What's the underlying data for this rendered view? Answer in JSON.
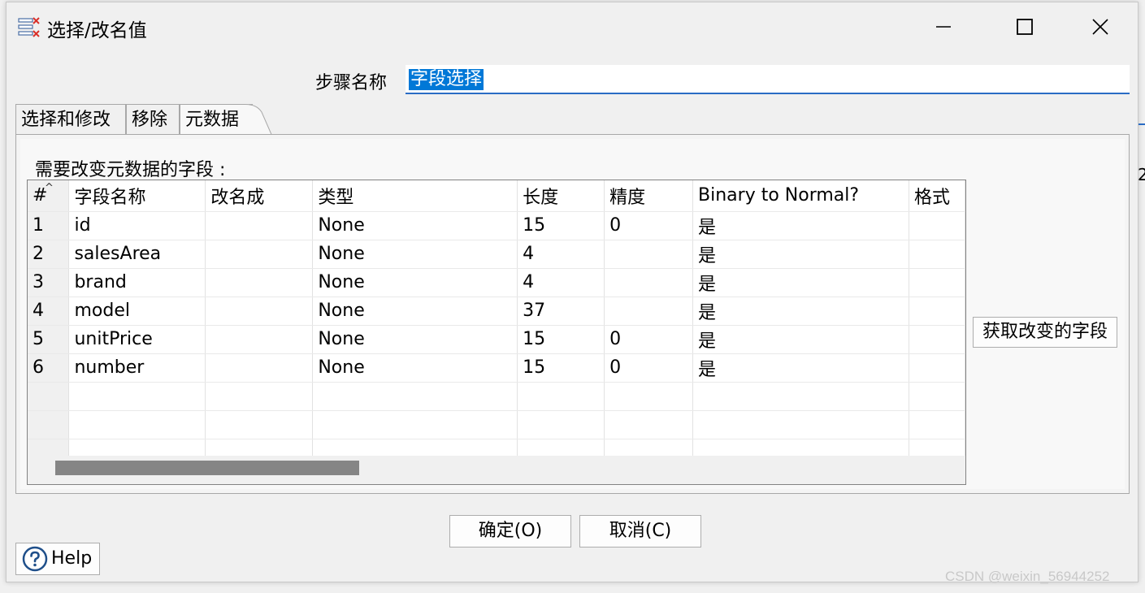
{
  "window": {
    "title": "选择/改名值"
  },
  "step_name": {
    "label": "步骤名称",
    "value": "字段选择"
  },
  "tabs": [
    {
      "label": "选择和修改",
      "active": false
    },
    {
      "label": "移除",
      "active": false
    },
    {
      "label": "元数据",
      "active": true
    }
  ],
  "metadata": {
    "section_label": "需要改变元数据的字段 :",
    "columns": [
      "#",
      "字段名称",
      "改名成",
      "类型",
      "长度",
      "精度",
      "Binary to Normal?",
      "格式"
    ],
    "rows": [
      [
        "1",
        "id",
        "",
        "None",
        "15",
        "0",
        "是",
        ""
      ],
      [
        "2",
        "salesArea",
        "",
        "None",
        "4",
        "",
        "是",
        ""
      ],
      [
        "3",
        "brand",
        "",
        "None",
        "4",
        "",
        "是",
        ""
      ],
      [
        "4",
        "model",
        "",
        "None",
        "37",
        "",
        "是",
        ""
      ],
      [
        "5",
        "unitPrice",
        "",
        "None",
        "15",
        "0",
        "是",
        ""
      ],
      [
        "6",
        "number",
        "",
        "None",
        "15",
        "0",
        "是",
        ""
      ]
    ],
    "get_fields_button": "获取改变的字段"
  },
  "buttons": {
    "ok": "确定(O)",
    "cancel": "取消(C)",
    "help": "Help"
  },
  "edge_glyph": "2",
  "watermark": "CSDN @weixin_56944252",
  "colors": {
    "selection": "#0078d7",
    "scroll_thumb": "#858585",
    "input_underline": "#2a6cc4"
  }
}
